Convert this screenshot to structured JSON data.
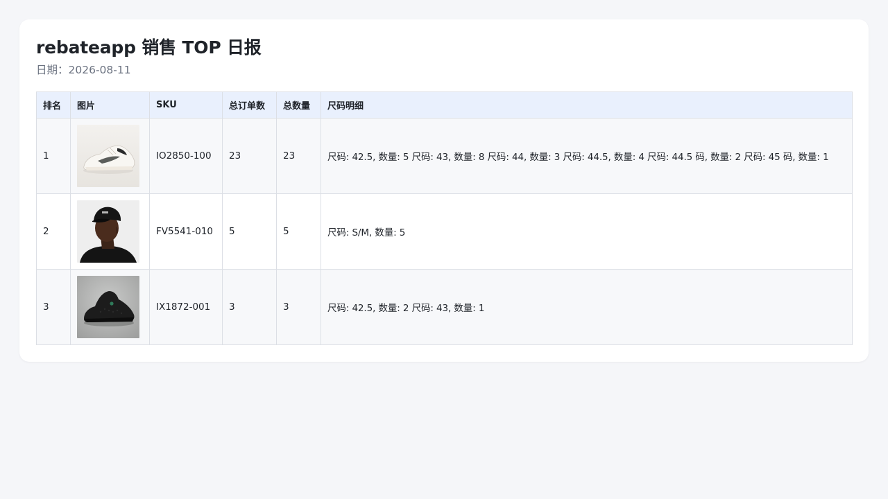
{
  "header": {
    "title": "rebateapp 销售 TOP 日报",
    "date_label": "日期：",
    "date_value": "2026-08-11"
  },
  "table": {
    "columns": [
      "排名",
      "图片",
      "SKU",
      "总订单数",
      "总数量",
      "尺码明细"
    ],
    "rows": [
      {
        "rank": "1",
        "image": "white-sneaker-image",
        "sku": "IO2850-100",
        "orders": "23",
        "quantity": "23",
        "sizes": "尺码: 42.5, 数量: 5 尺码: 43, 数量: 8 尺码: 44, 数量: 3 尺码: 44.5, 数量: 4 尺码: 44.5 码, 数量: 2 尺码: 45 码, 数量: 1"
      },
      {
        "rank": "2",
        "image": "black-cap-model-image",
        "sku": "FV5541-010",
        "orders": "5",
        "quantity": "5",
        "sizes": "尺码: S/M, 数量: 5"
      },
      {
        "rank": "3",
        "image": "black-high-top-sneaker-image",
        "sku": "IX1872-001",
        "orders": "3",
        "quantity": "3",
        "sizes": "尺码: 42.5, 数量: 2 尺码: 43, 数量: 1"
      }
    ]
  }
}
